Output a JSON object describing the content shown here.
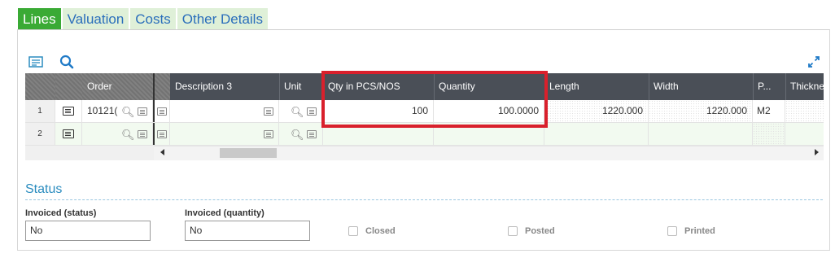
{
  "tabs": [
    {
      "label": "Lines",
      "active": true
    },
    {
      "label": "Valuation",
      "active": false
    },
    {
      "label": "Costs",
      "active": false
    },
    {
      "label": "Other Details",
      "active": false
    }
  ],
  "grid": {
    "columns": {
      "order": "Order",
      "description3": "Description 3",
      "unit": "Unit",
      "qty_pcs": "Qty in PCS/NOS",
      "quantity": "Quantity",
      "length": "Length",
      "width": "Width",
      "p": "P...",
      "thickness": "Thicknes"
    },
    "rows": [
      {
        "num": "1",
        "order": "10121(",
        "qty_pcs": "100",
        "quantity": "100.0000",
        "length": "1220.000",
        "width": "1220.000",
        "p": "M2"
      },
      {
        "num": "2",
        "order": "",
        "qty_pcs": "",
        "quantity": "",
        "length": "",
        "width": "",
        "p": ""
      }
    ]
  },
  "status": {
    "title": "Status",
    "invoiced_status_label": "Invoiced (status)",
    "invoiced_status_value": "No",
    "invoiced_quantity_label": "Invoiced (quantity)",
    "invoiced_quantity_value": "No",
    "closed_label": "Closed",
    "posted_label": "Posted",
    "printed_label": "Printed"
  },
  "colors": {
    "active_tab": "#3aaa35",
    "tab_bg": "#dff0d8",
    "link_blue": "#2a6ebb",
    "header_bg": "#4a4f57",
    "highlight": "#d9202c"
  }
}
